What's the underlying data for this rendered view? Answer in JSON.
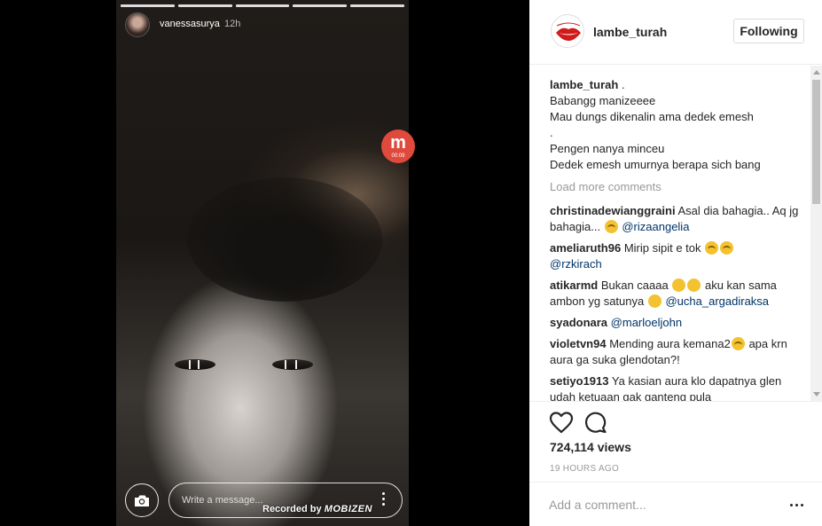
{
  "story": {
    "username": "vanessasurya",
    "time": "12h",
    "progress_segments": 5,
    "message_placeholder": "Write a message...",
    "recorded_by_prefix": "Recorded by",
    "recorded_by_brand": "MOBIZEN",
    "mobizen_badge_letter": "m",
    "mobizen_badge_time": "00:09",
    "icons": [
      "camera-icon",
      "more-vertical-icon"
    ]
  },
  "post": {
    "username": "lambe_turah",
    "follow_label": "Following",
    "caption": {
      "username": "lambe_turah",
      "first_line": ".",
      "lines": [
        "Babangg manizeeee",
        "Mau dungs dikenalin ama dedek emesh",
        ".",
        "Pengen nanya minceu",
        "Dedek emesh umurnya berapa sich bang"
      ]
    },
    "load_more": "Load more comments",
    "comments": [
      {
        "user": "christinadewianggraini",
        "text": "Asal dia bahagia.. Aq jg bahagia...",
        "mention": "@rizaangelia"
      },
      {
        "user": "ameliaruth96",
        "text": "Mirip sipit e tok",
        "mention": "@rzkirach"
      },
      {
        "user": "atikarmd",
        "text": "Bukan caaaa",
        "text2": "aku kan sama ambon yg satunya",
        "mention": "@ucha_argadiraksa"
      },
      {
        "user": "syadonara",
        "text": "",
        "mention": "@marloeljohn"
      },
      {
        "user": "violetvn94",
        "text": "Mending aura kemana2",
        "text2": "apa krn aura ga suka glendotan?!",
        "mention": ""
      },
      {
        "user": "setiyo1913",
        "text": "Ya kasian aura klo dapatnya glen udah ketuaan gak ganteng pula",
        "mention": ""
      }
    ],
    "views": "724,114 views",
    "timestamp": "19 HOURS AGO",
    "add_comment_placeholder": "Add a comment...",
    "icons": [
      "heart-icon",
      "comment-icon",
      "more-horizontal-icon"
    ],
    "colors": {
      "mention": "#003569",
      "muted": "#999999",
      "text": "#262626",
      "border": "#efefef"
    }
  }
}
